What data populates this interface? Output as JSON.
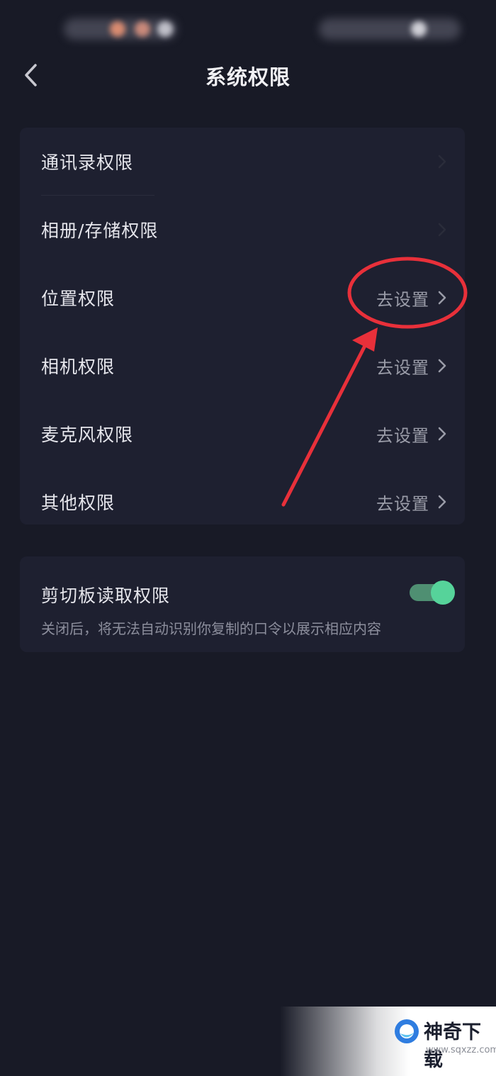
{
  "nav": {
    "title": "系统权限",
    "back_icon": "chevron-left-icon"
  },
  "permissions": [
    {
      "label": "通讯录权限",
      "action": ""
    },
    {
      "label": "相册/存储权限",
      "action": ""
    },
    {
      "label": "位置权限",
      "action": "去设置"
    },
    {
      "label": "相机权限",
      "action": "去设置"
    },
    {
      "label": "麦克风权限",
      "action": "去设置"
    },
    {
      "label": "其他权限",
      "action": "去设置"
    }
  ],
  "clipboard": {
    "label": "剪切板读取权限",
    "description": "关闭后，将无法自动识别你复制的口令以展示相应内容",
    "enabled": true
  },
  "watermark": {
    "name": "神奇下载",
    "url": "www.sqxzz.com"
  },
  "colors": {
    "background": "#181a26",
    "card": "#1e2030",
    "toggle_on": "#56d39a",
    "annotation": "#e8303a"
  }
}
